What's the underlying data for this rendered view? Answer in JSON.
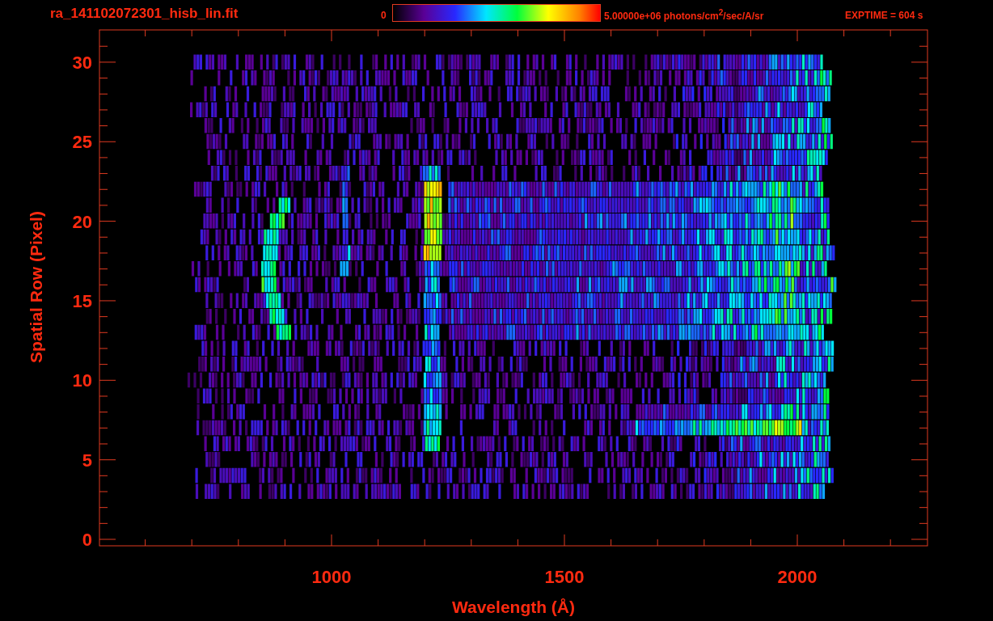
{
  "header": {
    "file_name": "ra_141102072301_hisb_lin.fit",
    "colorbar": {
      "min_label": "0",
      "max_label": "5.00000e+06 photons/cm$^{2}$/sec/A/sr"
    },
    "exposure": "EXPTIME = 604 s"
  },
  "plot": {
    "x_axis": {
      "title": "Wavelength (Å)",
      "ticks": [
        "1000",
        "1500",
        "2000"
      ]
    },
    "y_axis": {
      "title": "Spatial Row (Pixel)",
      "ticks": [
        "30",
        "25",
        "20",
        "15",
        "10",
        "5",
        "0"
      ]
    }
  }
}
